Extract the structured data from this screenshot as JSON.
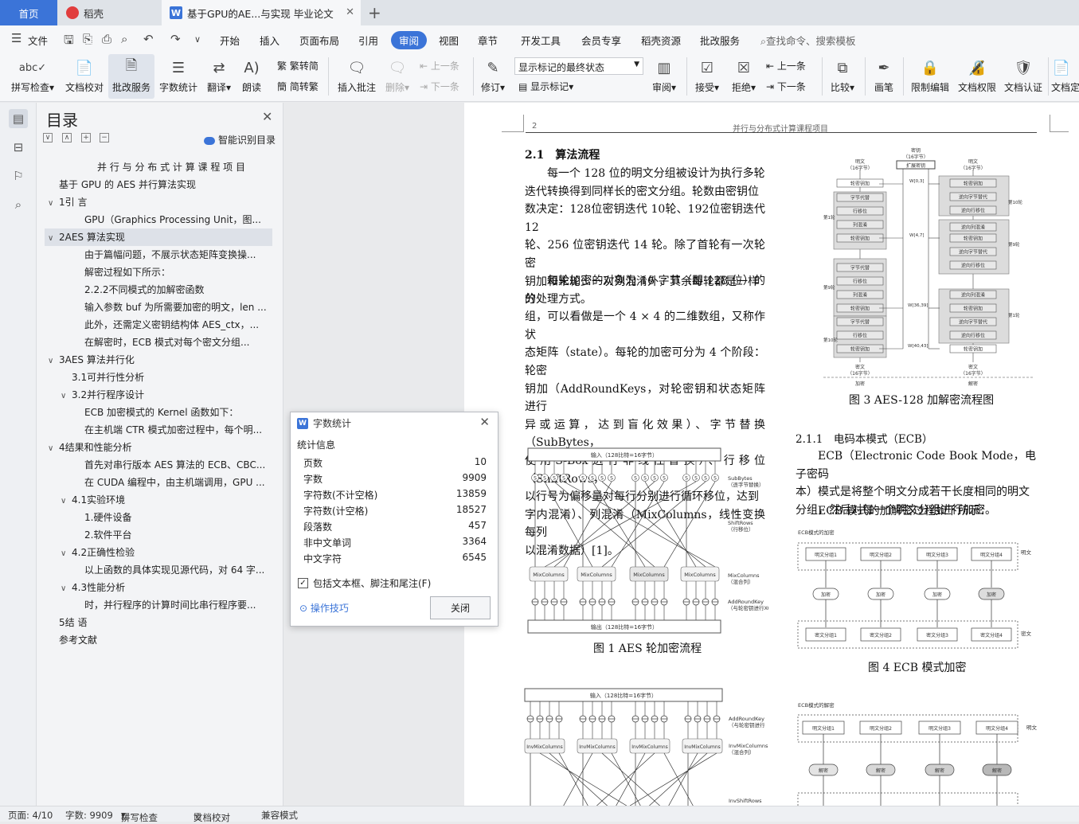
{
  "tabs": {
    "home": "首页",
    "daoke": "稻壳",
    "doc": "基于GPU的AE...与实现 毕业论文"
  },
  "menu": {
    "file": "文件",
    "items": [
      "开始",
      "插入",
      "页面布局",
      "引用",
      "审阅",
      "视图",
      "章节",
      "开发工具",
      "会员专享",
      "稻壳资源",
      "批改服务"
    ],
    "active": "审阅",
    "search": "查找命令、搜索模板"
  },
  "ribbon": {
    "spell": "拼写检查",
    "proof": "文档校对",
    "review_service": "批改服务",
    "word_count": "字数统计",
    "translate": "翻译",
    "read": "朗读",
    "trad": "繁转简",
    "simp": "简转繁",
    "insert_comment": "插入批注",
    "delete": "删除",
    "prev": "上一条",
    "next": "下一条",
    "track": "修订",
    "markup_mode": "显示标记的最终状态",
    "show_markup": "显示标记",
    "review_pane": "审阅",
    "accept": "接受",
    "reject": "拒绝",
    "prev2": "上一条",
    "next2": "下一条",
    "compare": "比较",
    "pen": "画笔",
    "restrict": "限制编辑",
    "perm": "文档权限",
    "cert": "文档认证",
    "final": "文档定"
  },
  "toc": {
    "title": "目录",
    "smart": "智能识别目录",
    "items": [
      {
        "text": "并 行 与 分 布 式 计 算 课 程 项 目",
        "level": 0,
        "arrow": ""
      },
      {
        "text": "基于 GPU 的 AES 并行算法实现",
        "level": 1,
        "arrow": ""
      },
      {
        "text": "1引 言",
        "level": 1,
        "arrow": "∨"
      },
      {
        "text": "GPU（Graphics Processing Unit，图...",
        "level": 3,
        "arrow": ""
      },
      {
        "text": "2AES 算法实现",
        "level": 1,
        "arrow": "∨"
      },
      {
        "text": "由于篇幅问题，不展示状态矩阵变换操...",
        "level": 3,
        "arrow": ""
      },
      {
        "text": "解密过程如下所示：",
        "level": 3,
        "arrow": ""
      },
      {
        "text": "2.2.2不同模式的加解密函数",
        "level": 3,
        "arrow": ""
      },
      {
        "text": "输入参数 buf 为所需要加密的明文，len ...",
        "level": 3,
        "arrow": ""
      },
      {
        "text": "此外，还需定义密钥结构体 AES_ctx，...",
        "level": 3,
        "arrow": ""
      },
      {
        "text": "在解密时，ECB 模式对每个密文分组...",
        "level": 3,
        "arrow": ""
      },
      {
        "text": "3AES 算法并行化",
        "level": 1,
        "arrow": "∨"
      },
      {
        "text": "3.1可并行性分析",
        "level": 2,
        "arrow": ""
      },
      {
        "text": "3.2并行程序设计",
        "level": 2,
        "arrow": "∨"
      },
      {
        "text": "ECB 加密模式的 Kernel 函数如下：",
        "level": 3,
        "arrow": ""
      },
      {
        "text": "在主机端 CTR 模式加密过程中，每个明...",
        "level": 3,
        "arrow": ""
      },
      {
        "text": "4结果和性能分析",
        "level": 1,
        "arrow": "∨"
      },
      {
        "text": "首先对串行版本 AES 算法的 ECB、CBC...",
        "level": 3,
        "arrow": ""
      },
      {
        "text": "在 CUDA 编程中，由主机端调用，GPU ...",
        "level": 3,
        "arrow": ""
      },
      {
        "text": "4.1实验环境",
        "level": 2,
        "arrow": "∨"
      },
      {
        "text": "1.硬件设备",
        "level": 3,
        "arrow": ""
      },
      {
        "text": "2.软件平台",
        "level": 3,
        "arrow": ""
      },
      {
        "text": "4.2正确性检验",
        "level": 2,
        "arrow": "∨"
      },
      {
        "text": "以上函数的具体实现见源代码，对 64 字...",
        "level": 3,
        "arrow": ""
      },
      {
        "text": "4.3性能分析",
        "level": 2,
        "arrow": "∨"
      },
      {
        "text": "时，并行程序的计算时间比串行程序要...",
        "level": 3,
        "arrow": ""
      },
      {
        "text": "5结 语",
        "level": 1,
        "arrow": ""
      },
      {
        "text": "参考文献",
        "level": 1,
        "arrow": ""
      }
    ],
    "highlighted_index": 4
  },
  "page": {
    "number": "2",
    "header": "并行与分布式计算课程项目",
    "sec": "2.1　算法流程",
    "p1": [
      "每一个 128 位的明文分组被设计为执行多轮",
      "迭代转换得到同样长的密文分组。轮数由密钥位",
      "数决定：128位密钥迭代 10轮、192位密钥迭代 12",
      "轮、256 位密钥迭代 14 轮。除了首轮有一次轮密",
      "钥加和末轮少一次列混淆外，其余每轮都是一样",
      "的处理方式。"
    ],
    "p2": [
      "每轮加密的对象为 16 字节（即 128 位）的分",
      "组，可以看做是一个 4 × 4 的二维数组，又称作状",
      "态矩阵（state）。每轮的加密可分为 4 个阶段：轮密",
      "钥加（AddRoundKeys，对轮密钥和状态矩阵进行",
      "异或运算，达到盲化效果）、字节替换（SubBytes，",
      "使用S-Box进行非线性替换）、行移位（ShiftRows，",
      "以行号为偏移量对每行分别进行循环移位，达到",
      "字内混淆）、列混淆（MixColumns，线性变换每列",
      "以混淆数据）[1]。"
    ],
    "fig1_caption": "图 1  AES 轮加密流程",
    "fig3_caption": "图 3  AES-128 加解密流程图",
    "sec2": "2.1.1　电码本模式（ECB）",
    "p3": [
      "ECB（Electronic Code Book Mode，电子密码",
      "本）模式是将整个明文分成若干长度相同的明文",
      "分组，然后对每一个明文分组进行加密。"
    ],
    "p4": "ECB 模式的加解密过程如下所示：",
    "fig4_caption": "图 4  ECB 模式加密",
    "fig1": {
      "top": "输入（128比特=16字节）",
      "bottom": "输出（128比特=16字节）",
      "sbox": "S",
      "mix": "MixColumns",
      "l1": "SubBytes",
      "l1b": "（逐字节替换）",
      "l2": "ShiftRows",
      "l2b": "（行移位）",
      "l3": "MixColumns",
      "l3b": "（混合列）",
      "l4": "AddRoundKey",
      "l4b": "（与轮密钥进行XOR）"
    },
    "fig2": {
      "top": "输入（128比特=16字节）",
      "inv": "InvMixColumns",
      "l1": "AddRoundKey",
      "l1b": "（与轮密钥进行",
      "l2": "InvMixColumns",
      "l2b": "（混合列）",
      "l3": "InvShiftRows"
    },
    "fig3": {
      "key": "密钥",
      "key2": "（16字节）",
      "expand": "扩展密钥",
      "plain": "明文",
      "plain2": "（16字节）",
      "cipher": "密文",
      "cipher2": "（16字节）",
      "ark": "轮密钥加",
      "sb": "字节代替",
      "sr": "行移位",
      "mc": "列混淆",
      "isb": "逆向字节替代",
      "isr": "逆向行移位",
      "imc": "逆向列混淆",
      "enc": "加密",
      "dec": "解密",
      "w1": "W[0,3]",
      "w2": "W[4,7]",
      "w3": "W[36,39]",
      "w4": "W[40,43]",
      "r1": "第1轮",
      "r9": "第9轮",
      "r10": "第10轮"
    },
    "fig4": {
      "title": "ECB模式的加密",
      "blocks": [
        "明文分组1",
        "明文分组2",
        "明文分组3",
        "明文分组4"
      ],
      "op": "加密",
      "out": [
        "密文分组1",
        "密文分组2",
        "密文分组3",
        "密文分组4"
      ],
      "side_top": "明文",
      "side_bottom": "密文"
    },
    "fig5": {
      "title": "ECB模式的解密",
      "blocks": [
        "明文分组1",
        "明文分组2",
        "明文分组3",
        "明文分组4"
      ],
      "op": "解密",
      "side": "明文"
    }
  },
  "dialog": {
    "title": "字数统计",
    "group": "统计信息",
    "rows": [
      {
        "k": "页数",
        "v": "10"
      },
      {
        "k": "字数",
        "v": "9909"
      },
      {
        "k": "字符数(不计空格)",
        "v": "13859"
      },
      {
        "k": "字符数(计空格)",
        "v": "18527"
      },
      {
        "k": "段落数",
        "v": "457"
      },
      {
        "k": "非中文单词",
        "v": "3364"
      },
      {
        "k": "中文字符",
        "v": "6545"
      }
    ],
    "checkbox": "包括文本框、脚注和尾注(F)",
    "tip": "操作技巧",
    "close": "关闭"
  },
  "status": {
    "page": "页面: 4/10",
    "words": "字数: 9909",
    "spell": "拼写检查",
    "proof": "文档校对",
    "compat": "兼容模式"
  }
}
